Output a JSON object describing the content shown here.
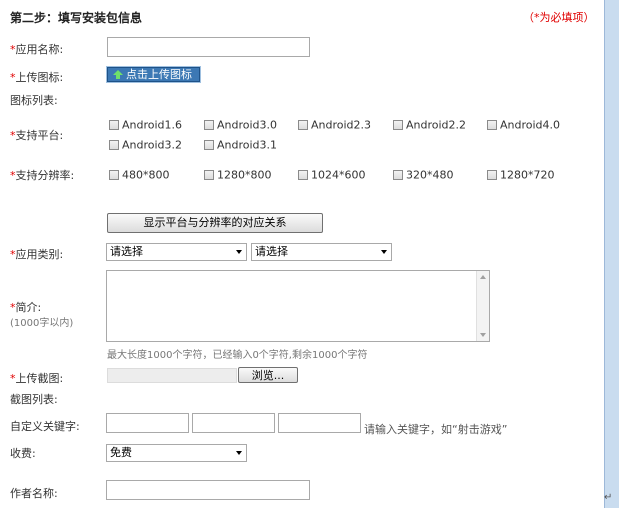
{
  "header": {
    "step_title": "第二步：填写安装包信息",
    "required_note": "（*为必填项）"
  },
  "form": {
    "app_name": {
      "label": "应用名称:",
      "value": ""
    },
    "icon_upload": {
      "label": "上传图标:",
      "button": "点击上传图标"
    },
    "icon_list": {
      "label": "图标列表:"
    },
    "platform": {
      "label": "支持平台:",
      "options": [
        "Android1.6",
        "Android3.0",
        "Android2.3",
        "Android2.2",
        "Android4.0",
        "Android3.2",
        "Android3.1"
      ]
    },
    "resolution": {
      "label": "支持分辨率:",
      "options": [
        "480*800",
        "1280*800",
        "1024*600",
        "320*480",
        "1280*720"
      ]
    },
    "show_mapping_button": "显示平台与分辨率的对应关系",
    "category": {
      "label": "应用类别:",
      "select1": "请选择",
      "select2": "请选择"
    },
    "intro": {
      "label": "简介:",
      "sublabel": "(1000字以内)",
      "value": "",
      "hint": "最大长度1000个字符，已经输入0个字符,剩余1000个字符"
    },
    "screenshot_upload": {
      "label": "上传截图:",
      "browse_button": "浏览..."
    },
    "screenshot_list": {
      "label": "截图列表:"
    },
    "keywords": {
      "label": "自定义关键字:",
      "hint": "请输入关键字，如“射击游戏”"
    },
    "charge": {
      "label": "收费:",
      "value": "免费"
    },
    "author": {
      "label": "作者名称:",
      "value": ""
    }
  },
  "colors": {
    "required": "#e00000",
    "upload_button": "#3c78b4",
    "side_bar": "#c9dcef"
  },
  "misc": {
    "paragraph_mark": "↵"
  }
}
